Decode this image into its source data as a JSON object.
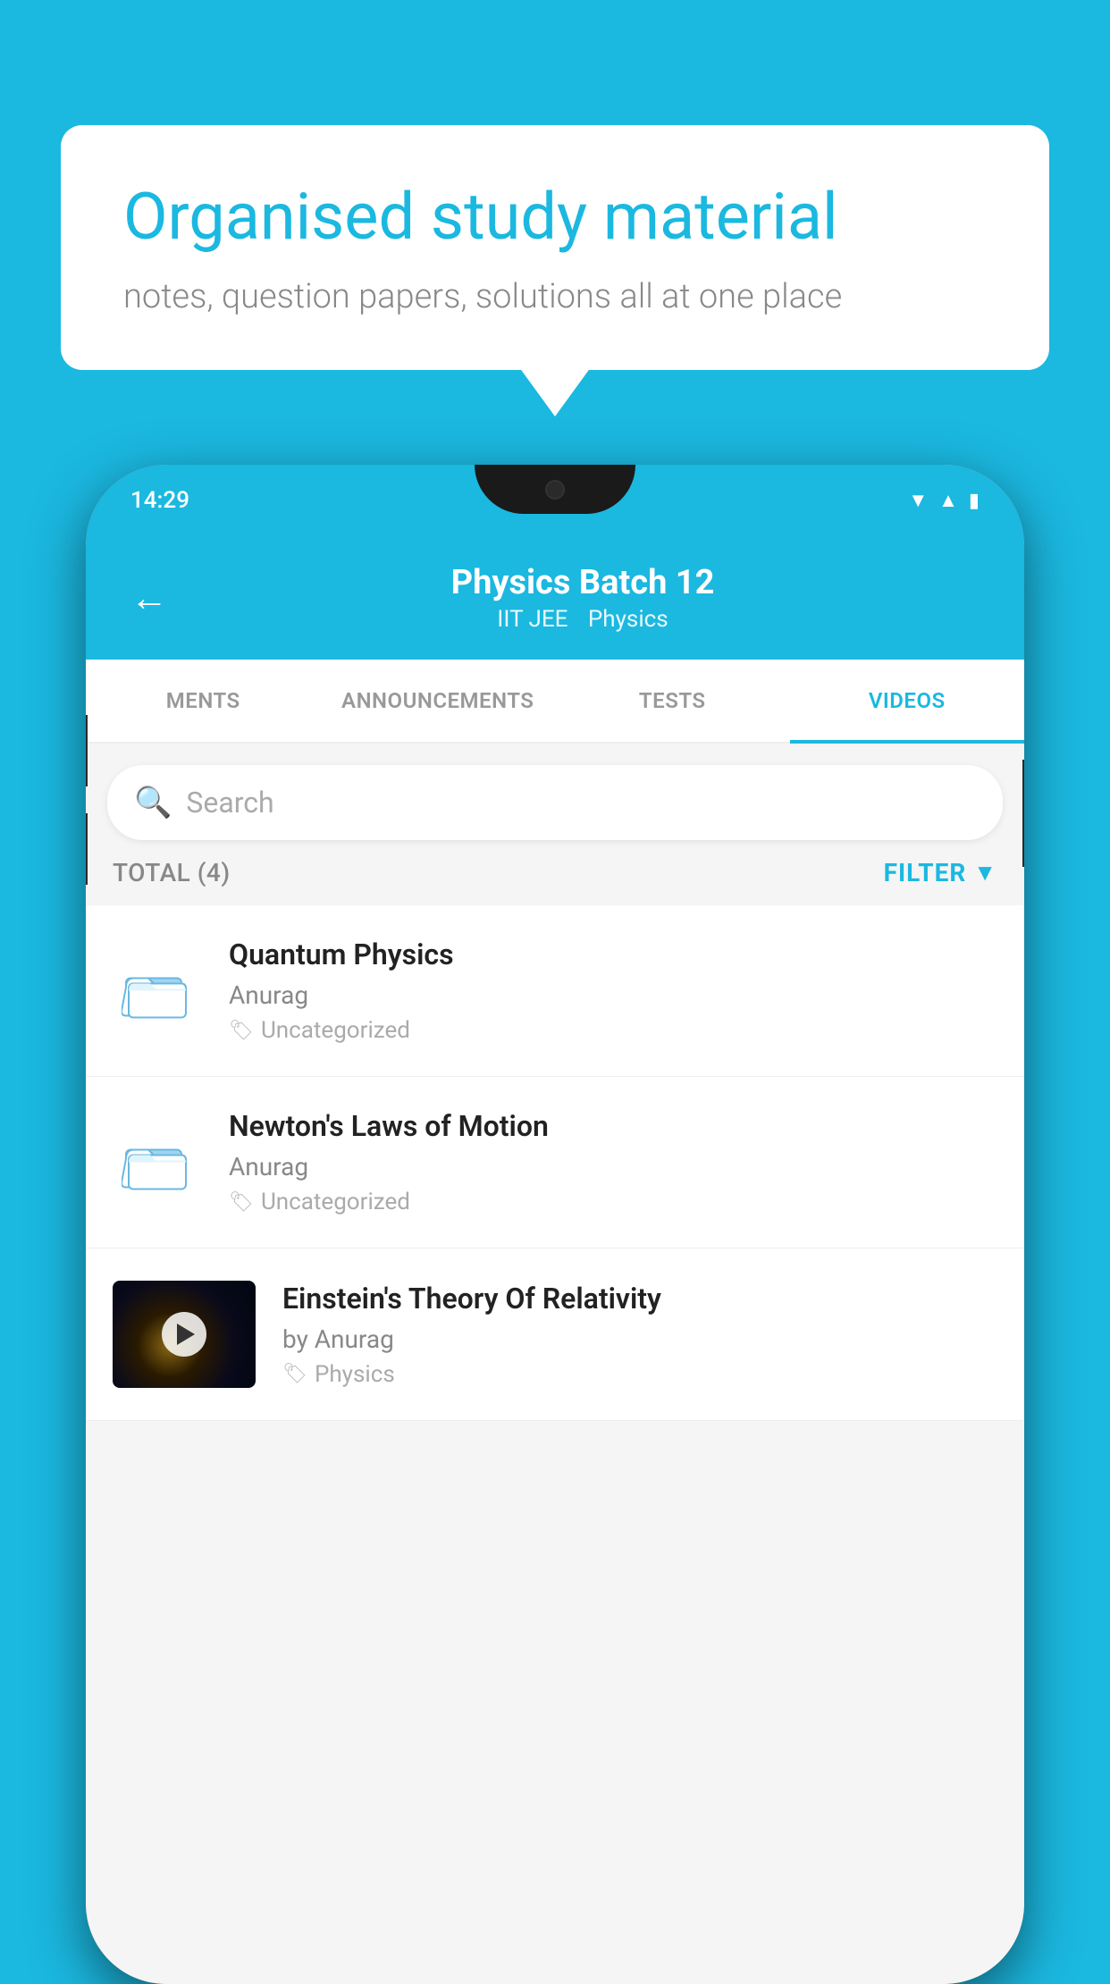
{
  "background_color": "#1bb8e0",
  "speech_bubble": {
    "title": "Organised study material",
    "subtitle": "notes, question papers, solutions all at one place"
  },
  "phone": {
    "status_bar": {
      "time": "14:29"
    },
    "header": {
      "back_label": "←",
      "title": "Physics Batch 12",
      "subtitle_parts": [
        "IIT JEE",
        "Physics"
      ]
    },
    "tabs": [
      {
        "label": "MENTS",
        "active": false
      },
      {
        "label": "ANNOUNCEMENTS",
        "active": false
      },
      {
        "label": "TESTS",
        "active": false
      },
      {
        "label": "VIDEOS",
        "active": true
      }
    ],
    "search": {
      "placeholder": "Search"
    },
    "filter_bar": {
      "total_label": "TOTAL (4)",
      "filter_label": "FILTER"
    },
    "videos": [
      {
        "id": "quantum-physics",
        "title": "Quantum Physics",
        "author": "Anurag",
        "tag": "Uncategorized",
        "has_thumbnail": false
      },
      {
        "id": "newtons-laws",
        "title": "Newton's Laws of Motion",
        "author": "Anurag",
        "tag": "Uncategorized",
        "has_thumbnail": false
      },
      {
        "id": "einstein-relativity",
        "title": "Einstein's Theory Of Relativity",
        "author": "by Anurag",
        "tag": "Physics",
        "has_thumbnail": true
      }
    ]
  }
}
